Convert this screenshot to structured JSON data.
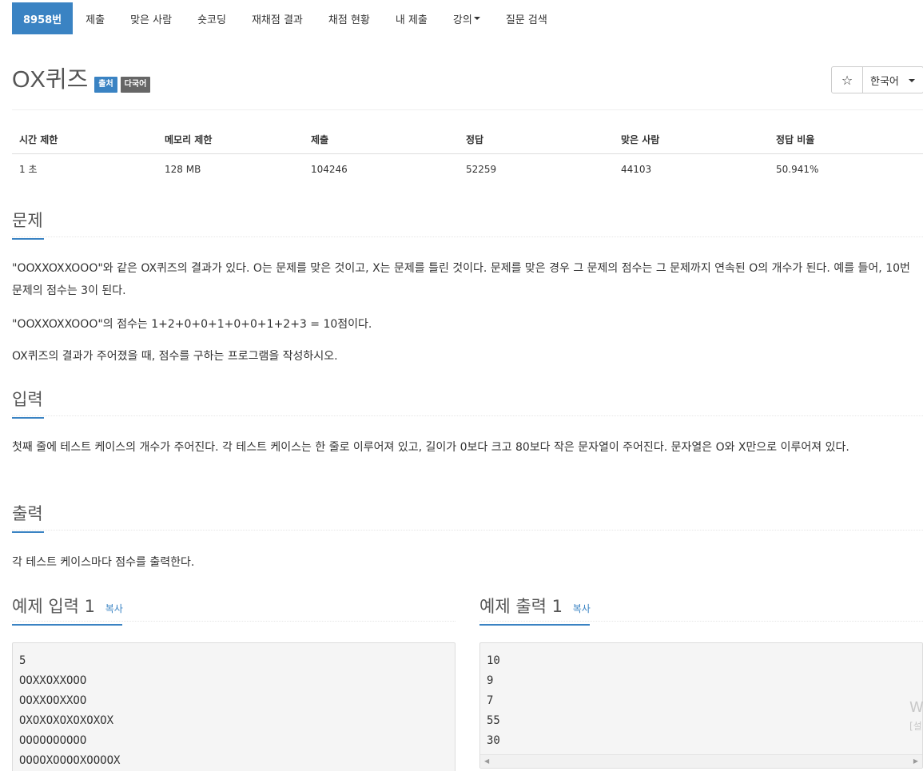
{
  "nav": {
    "items": [
      {
        "label": "8958번"
      },
      {
        "label": "제출"
      },
      {
        "label": "맞은 사람"
      },
      {
        "label": "숏코딩"
      },
      {
        "label": "재채점 결과"
      },
      {
        "label": "채점 현황"
      },
      {
        "label": "내 제출"
      },
      {
        "label": "강의"
      },
      {
        "label": "질문 검색"
      }
    ]
  },
  "problem": {
    "title": "OX퀴즈",
    "labels": [
      "출처",
      "다국어"
    ]
  },
  "toolbar": {
    "star_icon": "☆",
    "language": "한국어"
  },
  "stats": {
    "headers": [
      "시간 제한",
      "메모리 제한",
      "제출",
      "정답",
      "맞은 사람",
      "정답 비율"
    ],
    "values": [
      "1 초",
      "128 MB",
      "104246",
      "52259",
      "44103",
      "50.941%"
    ]
  },
  "sections": {
    "description": {
      "heading": "문제",
      "paragraphs": [
        "\"OOXXOXXOOO\"와 같은 OX퀴즈의 결과가 있다. O는 문제를 맞은 것이고, X는 문제를 틀린 것이다. 문제를 맞은 경우 그 문제의 점수는 그 문제까지 연속된 O의 개수가 된다. 예를 들어, 10번 문제의 점수는 3이 된다.",
        "\"OOXXOXXOOO\"의 점수는 1+2+0+0+1+0+0+1+2+3 = 10점이다.",
        "OX퀴즈의 결과가 주어졌을 때, 점수를 구하는 프로그램을 작성하시오."
      ]
    },
    "input": {
      "heading": "입력",
      "paragraph": "첫째 줄에 테스트 케이스의 개수가 주어진다. 각 테스트 케이스는 한 줄로 이루어져 있고, 길이가 0보다 크고 80보다 작은 문자열이 주어진다. 문자열은 O와 X만으로 이루어져 있다."
    },
    "output": {
      "heading": "출력",
      "paragraph": "각 테스트 케이스마다 점수를 출력한다."
    }
  },
  "samples": {
    "input": {
      "heading": "예제 입력 1",
      "copy": "복사",
      "lines": [
        "5",
        "OOXXOXXOOO",
        "OOXXOOXXOO",
        "OXOXOXOXOXOXOX",
        "OOOOOOOOOO",
        "OOOOXOOOOXOOOOX"
      ]
    },
    "output": {
      "heading": "예제 출력 1",
      "copy": "복사",
      "lines": [
        "10",
        "9",
        "7",
        "55",
        "30"
      ]
    }
  },
  "watermark": {
    "line1": "W",
    "line2": "[설"
  }
}
